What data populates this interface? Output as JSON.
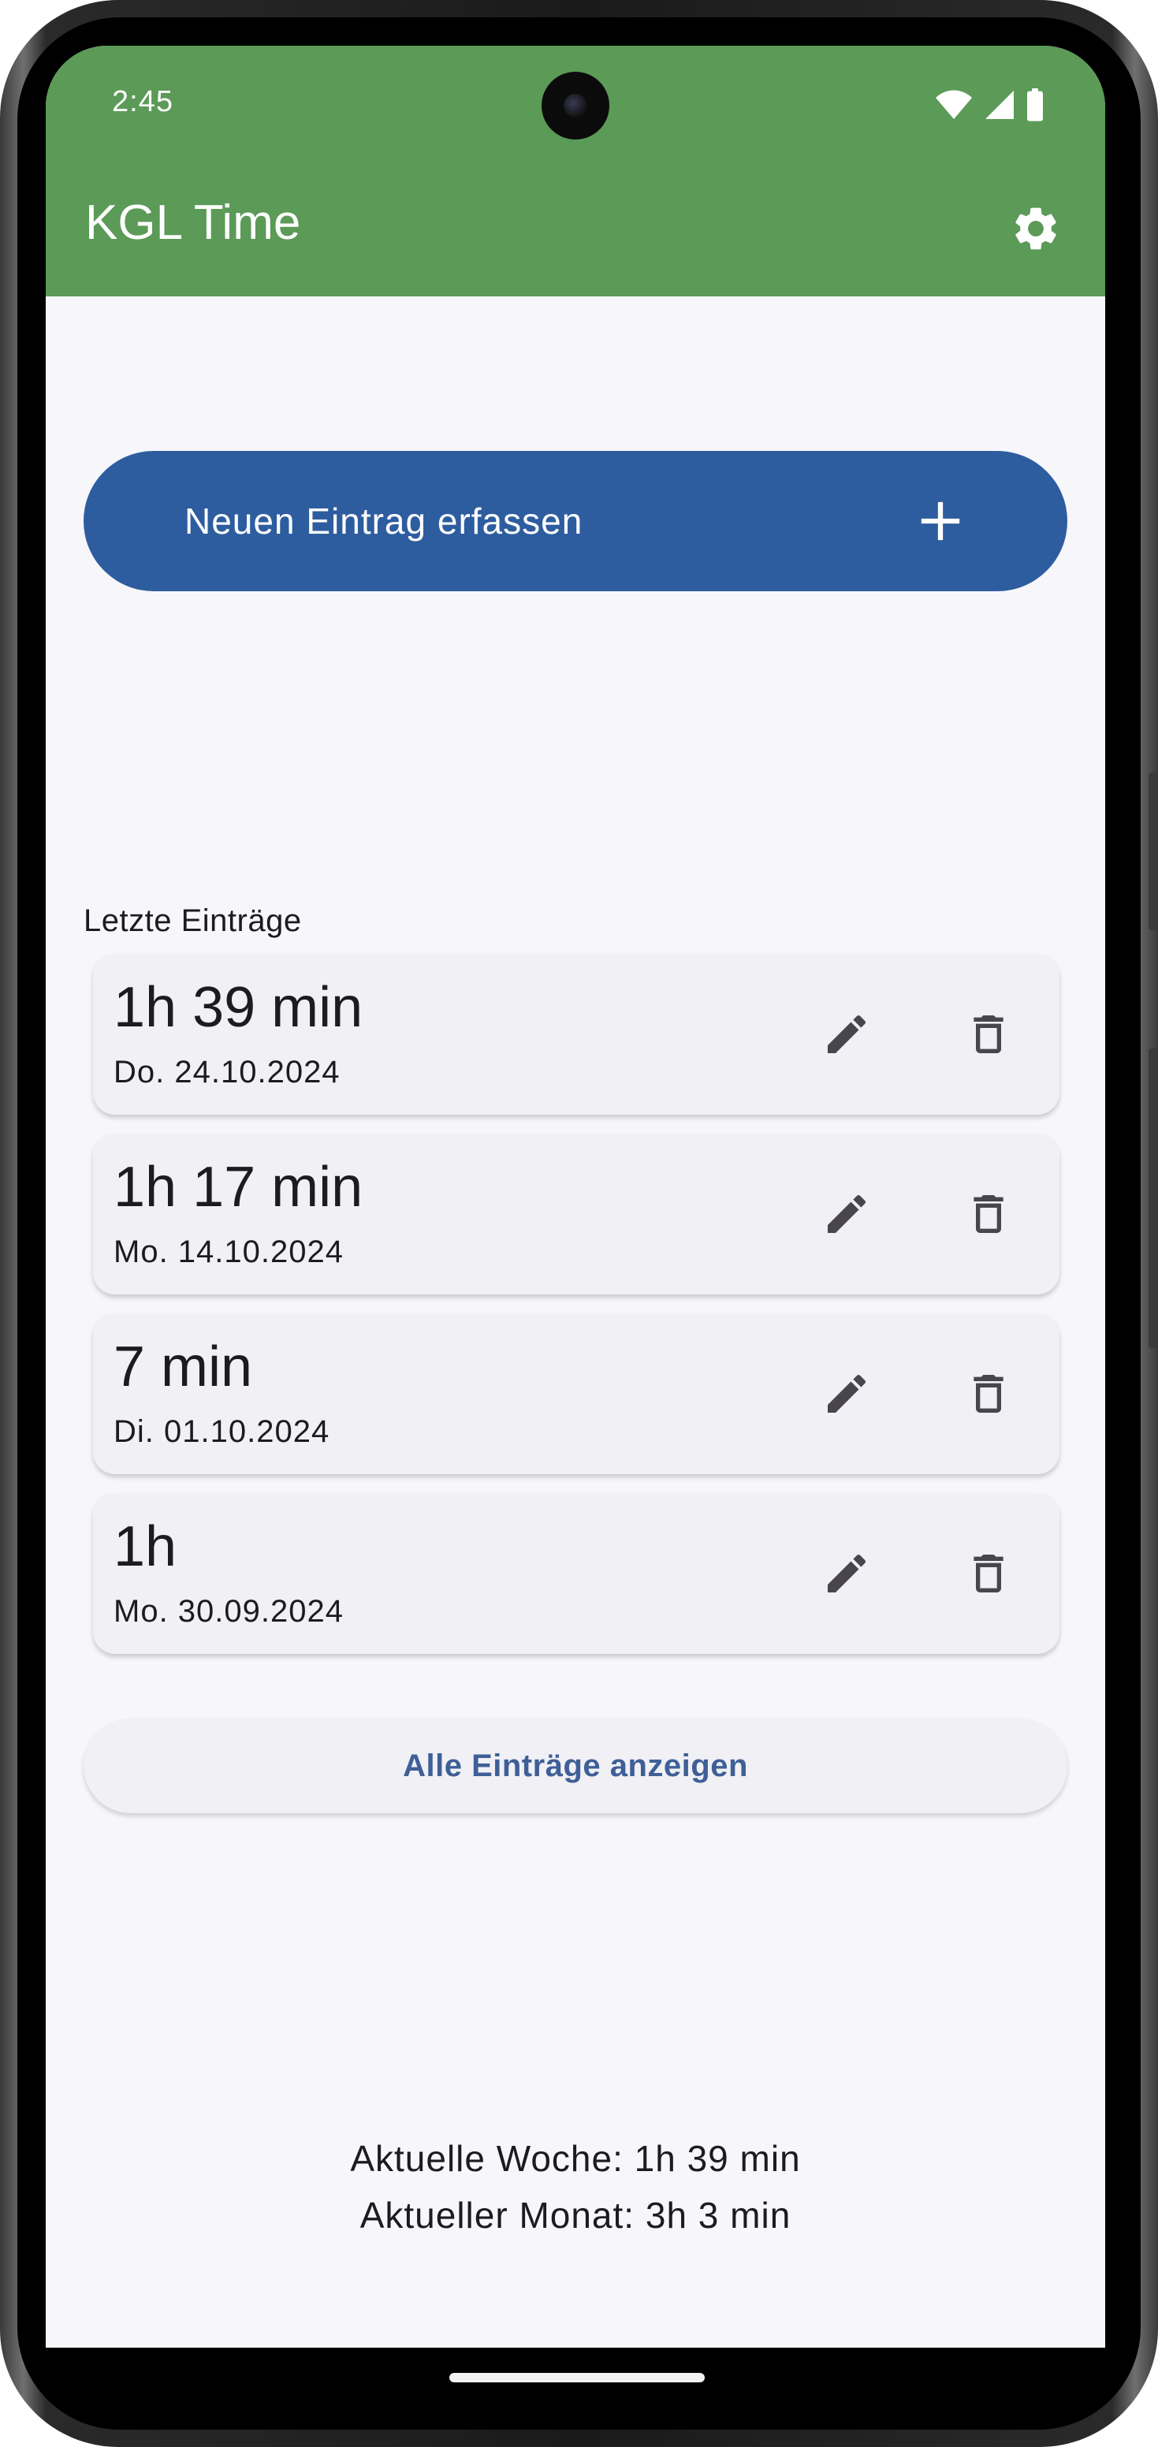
{
  "status_bar": {
    "time": "2:45",
    "icons": [
      "wifi-icon",
      "signal-icon",
      "battery-icon"
    ]
  },
  "app_bar": {
    "title": "KGL Time",
    "settings_icon": "gear-icon",
    "color": "#5b9a57"
  },
  "new_entry_button": {
    "label": "Neuen Eintrag erfassen",
    "icon": "plus-icon",
    "color": "#2d5d9f"
  },
  "recent": {
    "title": "Letzte Einträge",
    "entries": [
      {
        "duration": "1h 39 min",
        "date": "Do. 24.10.2024"
      },
      {
        "duration": "1h 17 min",
        "date": "Mo. 14.10.2024"
      },
      {
        "duration": "7 min",
        "date": "Di. 01.10.2024"
      },
      {
        "duration": "1h",
        "date": "Mo. 30.09.2024"
      }
    ],
    "edit_icon": "pencil-icon",
    "delete_icon": "trash-icon"
  },
  "all_entries_button": {
    "label": "Alle Einträge anzeigen"
  },
  "summary": {
    "week": "Aktuelle Woche: 1h 39 min",
    "month": "Aktueller Monat: 3h 3 min"
  }
}
